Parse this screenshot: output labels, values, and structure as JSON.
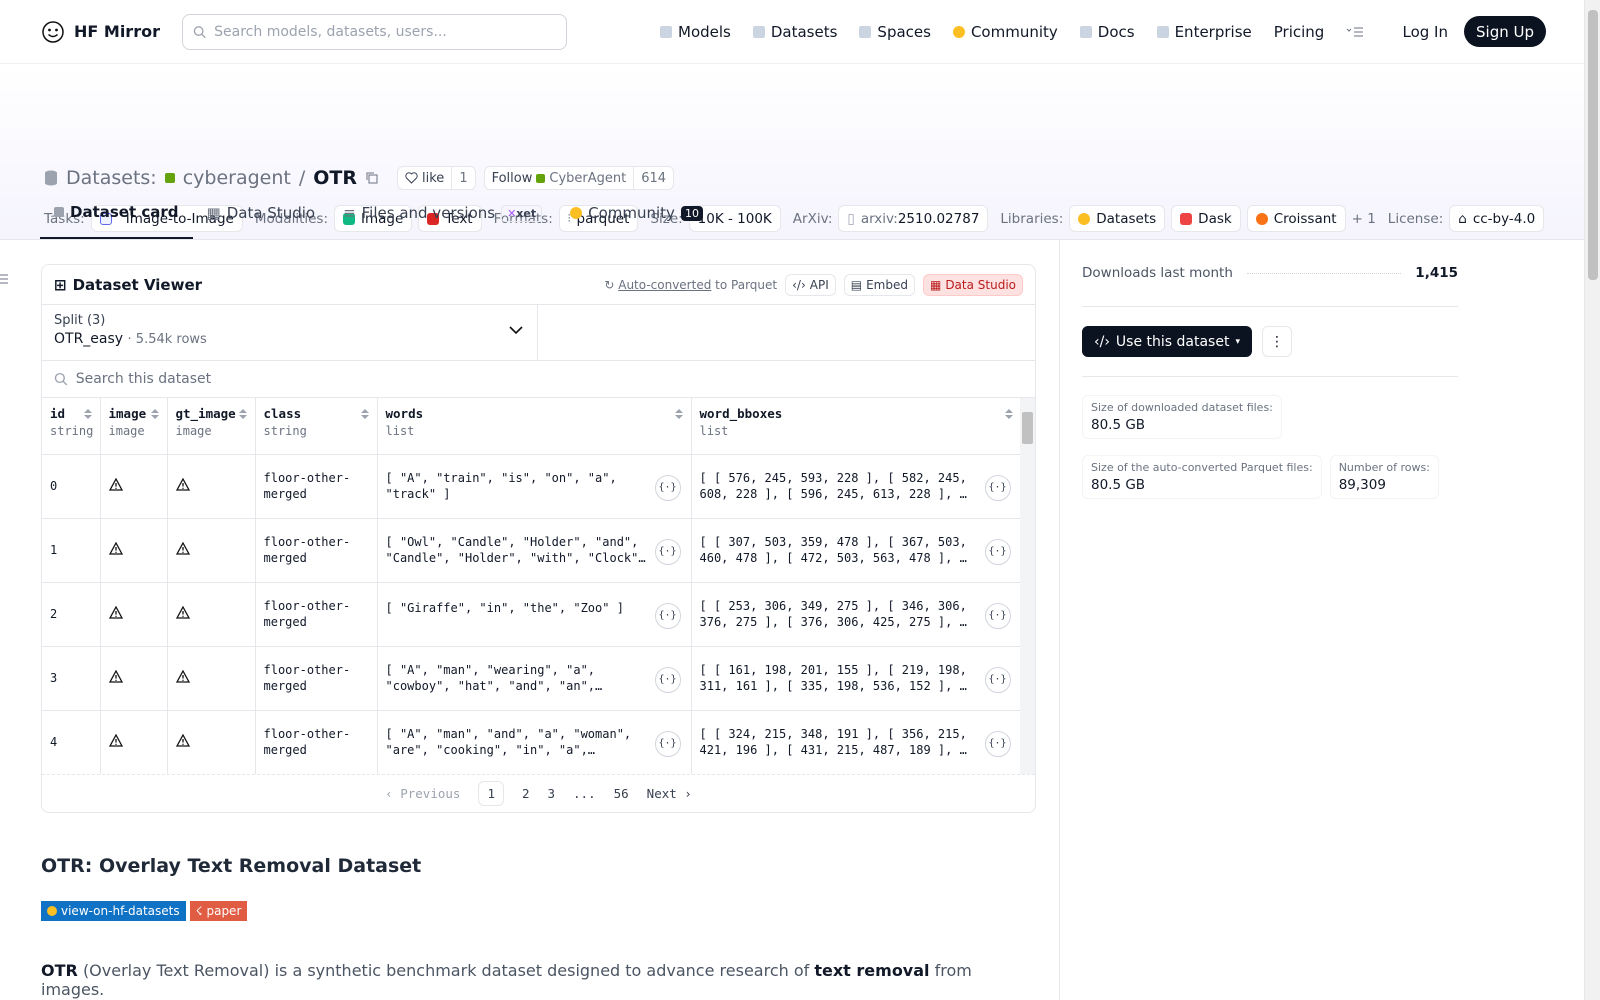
{
  "nav": {
    "brand": "HF Mirror",
    "search_placeholder": "Search models, datasets, users...",
    "links": [
      "Models",
      "Datasets",
      "Spaces",
      "Community",
      "Docs",
      "Enterprise",
      "Pricing"
    ],
    "login": "Log In",
    "signup": "Sign Up"
  },
  "header": {
    "section": "Datasets:",
    "owner": "cyberagent",
    "sep": "/",
    "name": "OTR",
    "like_label": "like",
    "like_count": "1",
    "follow_label": "Follow",
    "follow_org": "CyberAgent",
    "follow_count": "614",
    "tasks_label": "Tasks:",
    "task": "Image-to-Image",
    "modalities_label": "Modalities:",
    "modalities": [
      "Image",
      "Text"
    ],
    "formats_label": "Formats:",
    "format": "parquet",
    "size_label": "Size:",
    "size": "10K - 100K",
    "arxiv_label": "ArXiv:",
    "arxiv_prefix": "arxiv:",
    "arxiv_id": "2510.02787",
    "libraries_label": "Libraries:",
    "libraries": [
      "Datasets",
      "Dask",
      "Croissant"
    ],
    "libraries_more": "+ 1",
    "license_label": "License:",
    "license": "cc-by-4.0"
  },
  "tabs": [
    {
      "label": "Dataset card"
    },
    {
      "label": "Data Studio"
    },
    {
      "label": "Files and versions",
      "badge": "xet"
    },
    {
      "label": "Community",
      "badge": "10"
    }
  ],
  "viewer": {
    "title": "Dataset Viewer",
    "auto": "Auto-converted",
    "to_parquet": "to Parquet",
    "api": "API",
    "embed": "Embed",
    "studio": "Data Studio",
    "split_label": "Split (3)",
    "split_value": "OTR_easy",
    "split_rows": "5.54k rows",
    "search_placeholder": "Search this dataset",
    "columns": [
      {
        "name": "id",
        "type": "string"
      },
      {
        "name": "image",
        "type": "image"
      },
      {
        "name": "gt_image",
        "type": "image"
      },
      {
        "name": "class",
        "type": "string"
      },
      {
        "name": "words",
        "type": "list"
      },
      {
        "name": "word_bboxes",
        "type": "list"
      }
    ],
    "rows": [
      {
        "id": "0",
        "class": "floor-other-merged",
        "words": "[ \"A\", \"train\", \"is\", \"on\", \"a\", \"track\" ]",
        "bboxes": "[ [ 576, 245, 593, 228 ], [ 582, 245, 608, 228 ], [ 596, 245, 613, 228 ], …"
      },
      {
        "id": "1",
        "class": "floor-other-merged",
        "words": "[ \"Owl\", \"Candle\", \"Holder\", \"and\", \"Candle\", \"Holder\", \"with\", \"Clock\" ]",
        "bboxes": "[ [ 307, 503, 359, 478 ], [ 367, 503, 460, 478 ], [ 472, 503, 563, 478 ], …"
      },
      {
        "id": "2",
        "class": "floor-other-merged",
        "words": "[ \"Giraffe\", \"in\", \"the\", \"Zoo\" ]",
        "bboxes": "[ [ 253, 306, 349, 275 ], [ 346, 306, 376, 275 ], [ 376, 306, 425, 275 ], …"
      },
      {
        "id": "3",
        "class": "floor-other-merged",
        "words": "[ \"A\", \"man\", \"wearing\", \"a\", \"cowboy\", \"hat\", \"and\", \"an\", \"apron\"…",
        "bboxes": "[ [ 161, 198, 201, 155 ], [ 219, 198, 311, 161 ], [ 335, 198, 536, 152 ], …"
      },
      {
        "id": "4",
        "class": "floor-other-merged",
        "words": "[ \"A\", \"man\", \"and\", \"a\", \"woman\", \"are\", \"cooking\", \"in\", \"a\", \"kitchen…",
        "bboxes": "[ [ 324, 215, 348, 191 ], [ 356, 215, 421, 196 ], [ 431, 215, 487, 189 ], …"
      }
    ],
    "pager": {
      "prev": "Previous",
      "pages": [
        "1",
        "2",
        "3",
        "...",
        "56"
      ],
      "next": "Next"
    }
  },
  "card": {
    "title": "OTR: Overlay Text Removal Dataset",
    "badge1": "view-on-hf-datasets",
    "badge2": "paper",
    "p_lead": "OTR",
    "p_mid": "(Overlay Text Removal) is a synthetic benchmark dataset designed to advance research of",
    "p_bold": "text removal",
    "p_end": "from images."
  },
  "sidebar": {
    "downloads_label": "Downloads last month",
    "downloads": "1,415",
    "use_label": "Use this dataset",
    "stats": [
      {
        "label": "Size of downloaded dataset files:",
        "value": "80.5 GB"
      },
      {
        "label": "Size of the auto-converted Parquet files:",
        "value": "80.5 GB"
      },
      {
        "label": "Number of rows:",
        "value": "89,309"
      }
    ]
  },
  "colors": {
    "accent_dark": "#0b1220",
    "studio_red": "#b91c1c",
    "badge_blue": "#0f72c4",
    "badge_red": "#e05d44"
  }
}
